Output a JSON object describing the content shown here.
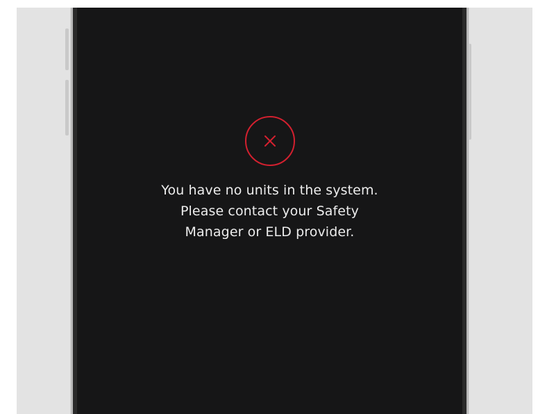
{
  "screen": {
    "error_icon": "close-circle-icon",
    "message_lines": [
      "You have no units in the system.",
      "Please contact your Safety",
      "Manager or ELD provider."
    ]
  },
  "colors": {
    "background": "#161617",
    "error_red": "#d3202f",
    "text": "#ececec"
  }
}
